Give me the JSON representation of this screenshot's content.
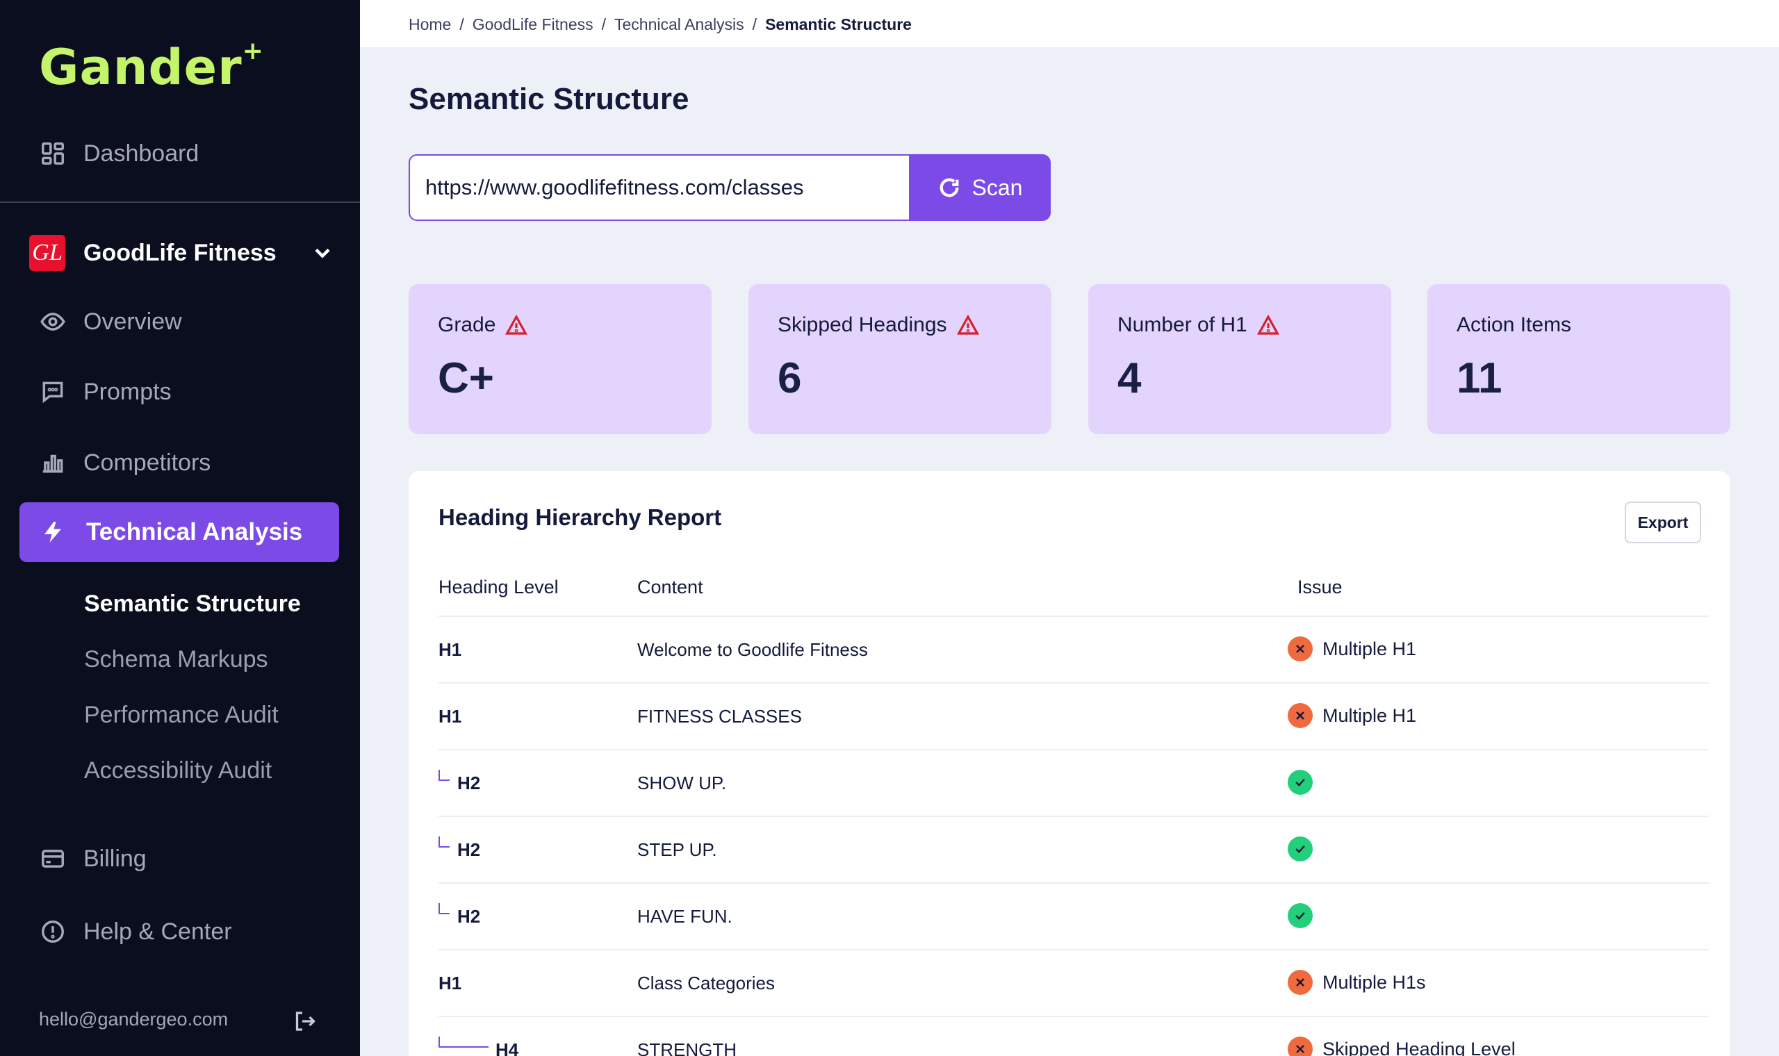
{
  "app": {
    "logo": "Gander",
    "logo_mark": "+"
  },
  "sidebar": {
    "dashboard": "Dashboard",
    "org": {
      "badge": "GL",
      "name": "GoodLife Fitness"
    },
    "items": [
      {
        "label": "Overview",
        "icon": "eye-icon"
      },
      {
        "label": "Prompts",
        "icon": "chat-icon"
      },
      {
        "label": "Competitors",
        "icon": "bar-chart-icon"
      }
    ],
    "active": "Technical Analysis",
    "subitems": [
      "Semantic Structure",
      "Schema Markups",
      "Performance Audit",
      "Accessibility Audit"
    ],
    "billing": "Billing",
    "help": "Help & Center",
    "email": "hello@gandergeo.com"
  },
  "breadcrumb": [
    "Home",
    "GoodLife Fitness",
    "Technical Analysis",
    "Semantic Structure"
  ],
  "page": {
    "title": "Semantic Structure"
  },
  "scan": {
    "url": "https://www.goodlifefitness.com/classes",
    "button": "Scan"
  },
  "cards": [
    {
      "title": "Grade",
      "value": "C+",
      "warning": true
    },
    {
      "title": "Skipped Headings",
      "value": "6",
      "warning": true
    },
    {
      "title": "Number of H1",
      "value": "4",
      "warning": true
    },
    {
      "title": "Action Items",
      "value": "11",
      "warning": false
    }
  ],
  "report": {
    "title": "Heading Hierarchy Report",
    "export": "Export",
    "columns": [
      "Heading Level",
      "Content",
      "Issue"
    ],
    "rows": [
      {
        "level": "H1",
        "content": "Welcome to Goodlife Fitness",
        "issue": "Multiple H1",
        "status": "error"
      },
      {
        "level": "H1",
        "content": "FITNESS CLASSES",
        "issue": "Multiple H1",
        "status": "error"
      },
      {
        "level": "H2",
        "content": "SHOW UP.",
        "issue": "",
        "status": "ok"
      },
      {
        "level": "H2",
        "content": "STEP UP.",
        "issue": "",
        "status": "ok"
      },
      {
        "level": "H2",
        "content": "HAVE FUN.",
        "issue": "",
        "status": "ok"
      },
      {
        "level": "H1",
        "content": "Class Categories",
        "issue": "Multiple H1s",
        "status": "error"
      },
      {
        "level": "H4",
        "content": "STRENGTH",
        "issue": "Skipped Heading Level",
        "status": "error"
      }
    ]
  },
  "colors": {
    "accent": "#7c4ae6",
    "sidebar_bg": "#0a0e1f",
    "logo": "#c4f46a",
    "card_bg": "#e3d4fd",
    "error": "#f06a3f",
    "ok": "#22d07c",
    "warn": "#d4202c"
  }
}
